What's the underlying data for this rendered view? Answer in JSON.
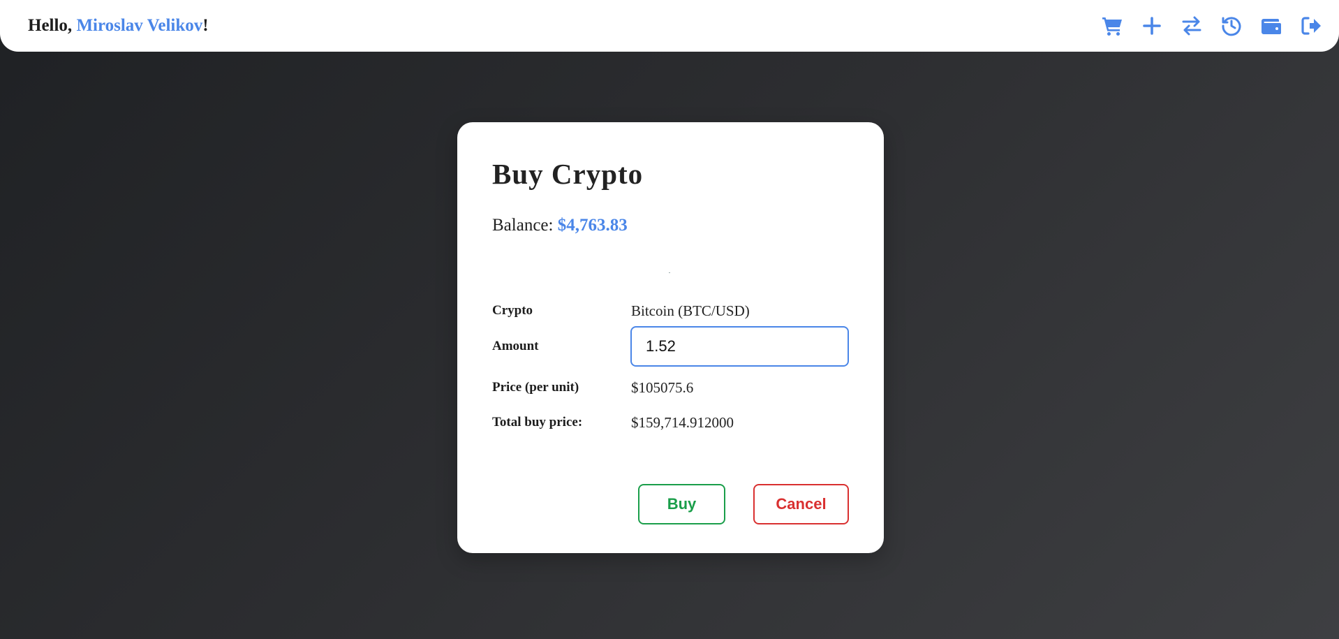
{
  "header": {
    "greeting_prefix": "Hello, ",
    "user_name": "Miroslav Velikov",
    "greeting_suffix": "!",
    "nav_icons": [
      "cart-icon",
      "plus-icon",
      "exchange-icon",
      "history-icon",
      "wallet-icon",
      "logout-icon"
    ],
    "accent_color": "#4a86e8"
  },
  "modal": {
    "title": "Buy Crypto",
    "balance_label": "Balance: ",
    "balance_value": "$4,763.83",
    "crypto_label": "Crypto",
    "crypto_value": "Bitcoin (BTC/USD)",
    "amount_label": "Amount",
    "amount_value": "1.52",
    "price_label": "Price (per unit)",
    "price_value": "$105075.6",
    "total_label": "Total buy price:",
    "total_value": "$159,714.912000",
    "buy_label": "Buy",
    "cancel_label": "Cancel",
    "buy_color": "#1a9e4a",
    "cancel_color": "#d93030"
  }
}
